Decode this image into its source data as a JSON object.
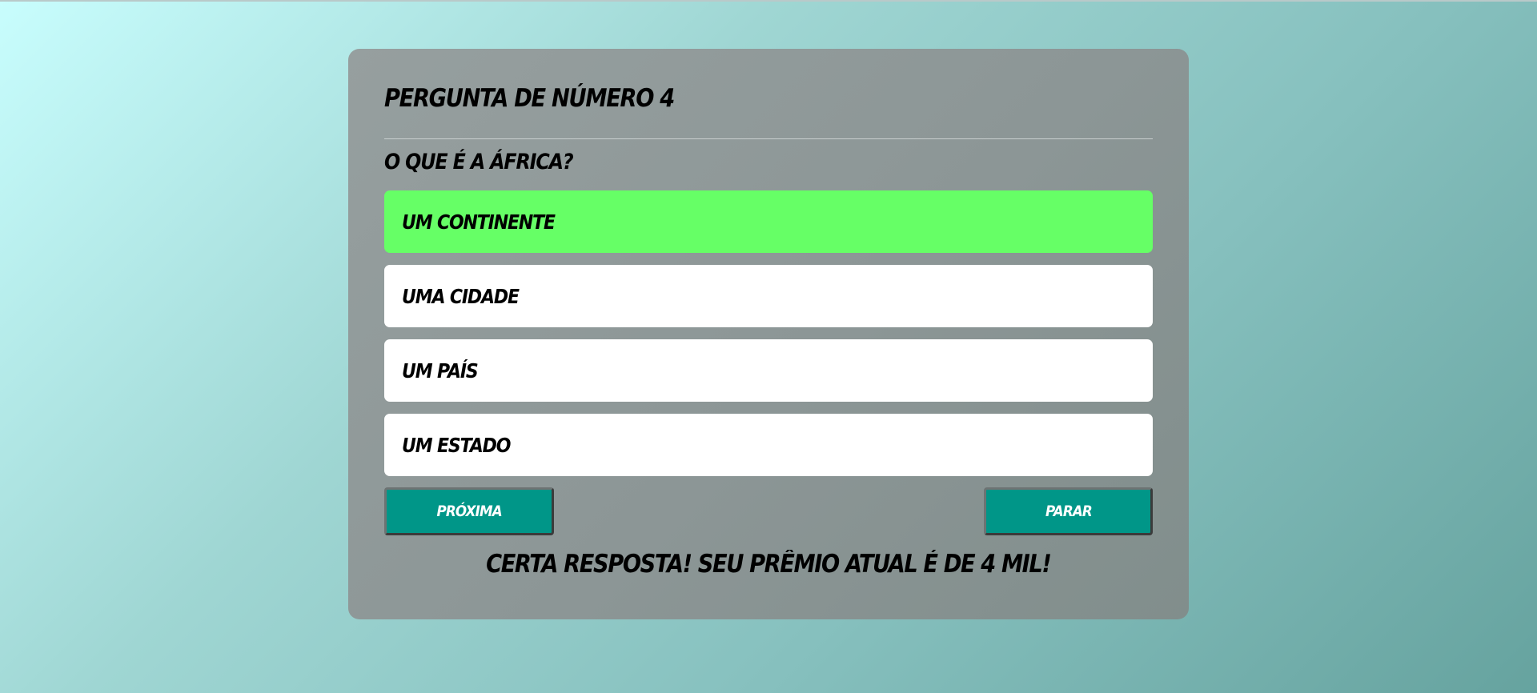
{
  "quiz": {
    "title": "PERGUNTA DE NÚMERO 4",
    "question": "O QUE É A ÁFRICA?",
    "options": [
      {
        "label": "UM CONTINENTE",
        "state": "correct"
      },
      {
        "label": "UMA CIDADE",
        "state": "default"
      },
      {
        "label": "UM PAÍS",
        "state": "default"
      },
      {
        "label": "UM ESTADO",
        "state": "default"
      }
    ],
    "next_label": "PRÓXIMA",
    "stop_label": "PARAR",
    "result_message": "CERTA RESPOSTA! SEU PRÊMIO ATUAL É DE 4 MIL!"
  },
  "colors": {
    "correct_option": "#66ff66",
    "button": "#009688",
    "card": "#8f9999"
  }
}
